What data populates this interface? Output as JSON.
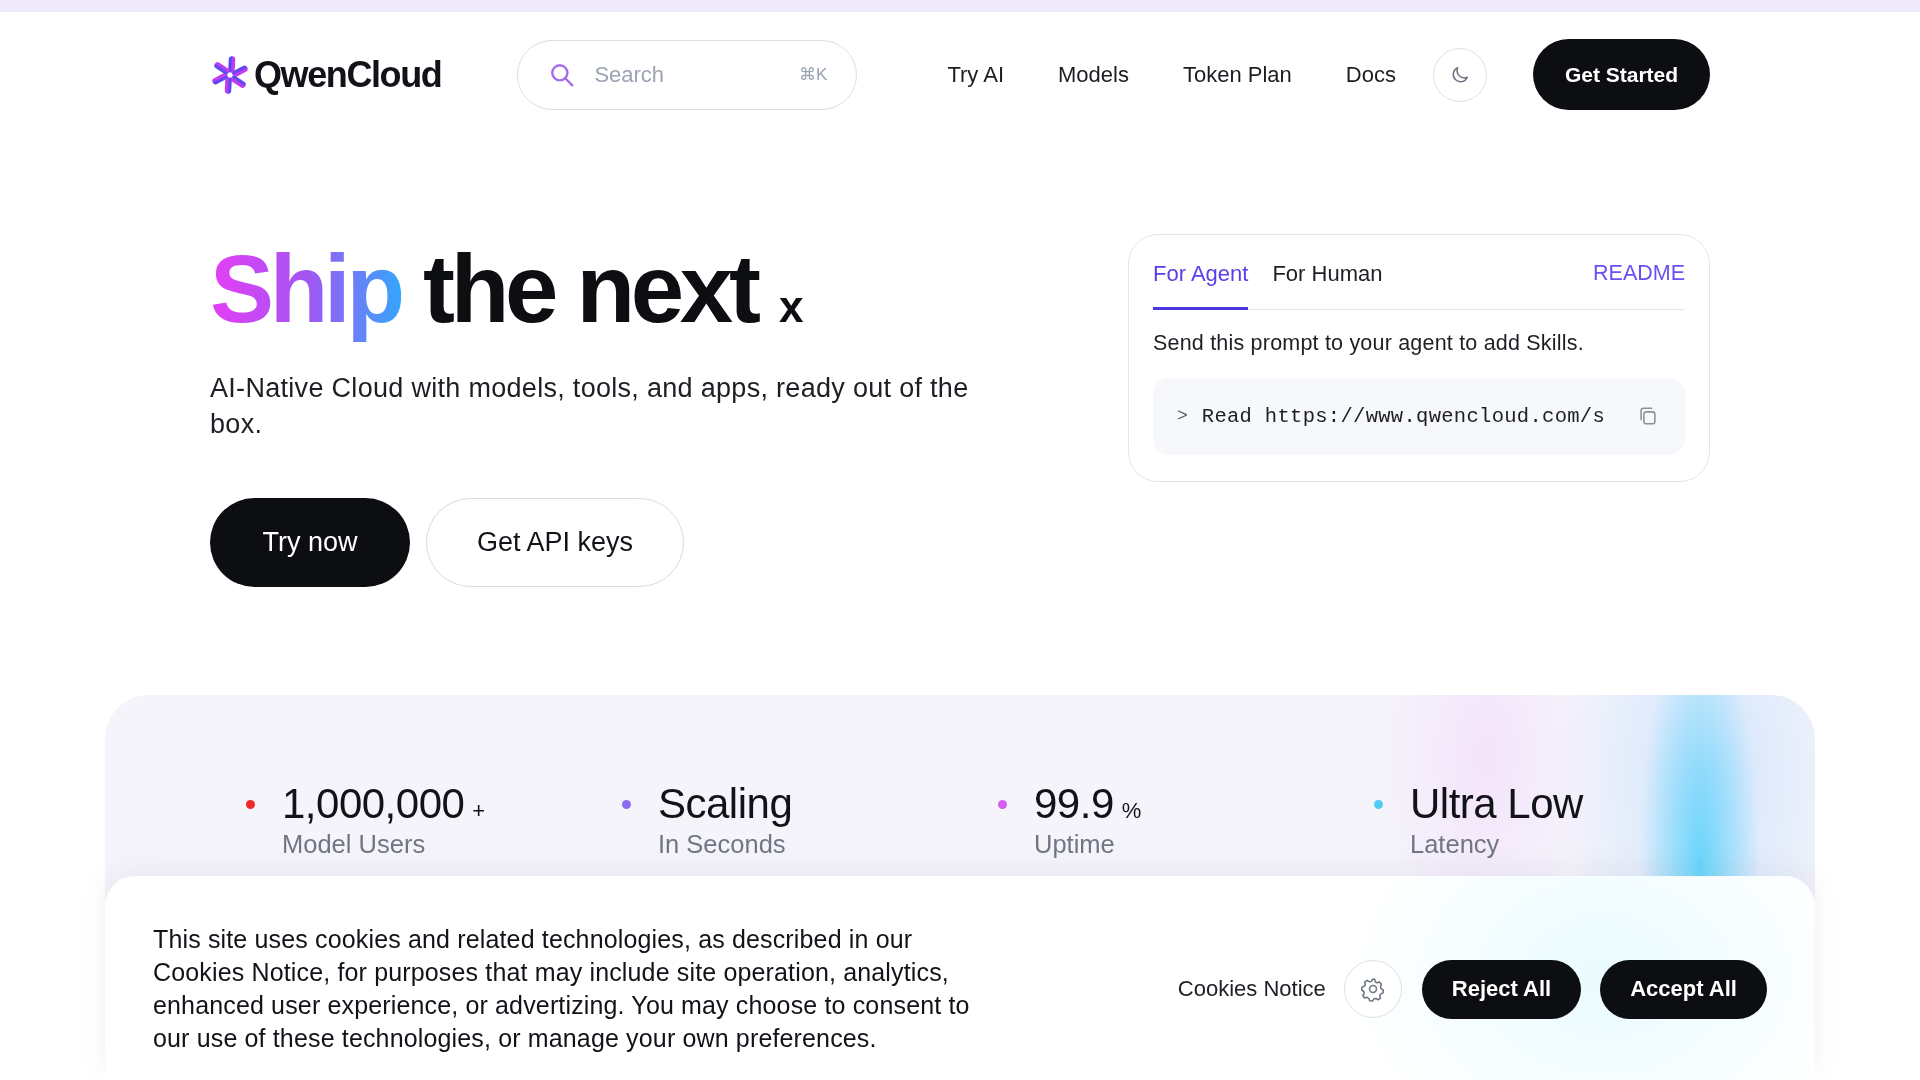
{
  "header": {
    "logo": "QwenCloud",
    "search": {
      "placeholder": "Search",
      "shortcut": "⌘K"
    },
    "nav": [
      "Try AI",
      "Models",
      "Token Plan",
      "Docs"
    ],
    "cta": "Get Started"
  },
  "hero": {
    "title": [
      {
        "text": "Ship",
        "kind": "gradient"
      },
      {
        "text": "the next",
        "kind": "plain"
      },
      {
        "text": "x",
        "kind": "small"
      }
    ],
    "subtitle": "AI-Native Cloud with models, tools, and apps, ready out of the box.",
    "buttons": [
      {
        "label": "Try now",
        "kind": "primary"
      },
      {
        "label": "Get API keys",
        "kind": "secondary"
      }
    ]
  },
  "prompt_card": {
    "tabs": [
      {
        "label": "For Agent",
        "selected": true
      },
      {
        "label": "For Human",
        "selected": false
      }
    ],
    "link": "README",
    "description": "Send this prompt to your agent to add Skills.",
    "prompt_marker": ">",
    "prompt": "Read https://www.qwencloud.com/s"
  },
  "stats": [
    {
      "value": "1,000,000",
      "suffix": "+",
      "label": "Model Users",
      "color": "#ee2b2b"
    },
    {
      "value": "Scaling",
      "label": "In Seconds",
      "color": "#8a6cf2"
    },
    {
      "value": "99.9",
      "suffix": "%",
      "label": "Uptime",
      "color": "#d75cf2"
    },
    {
      "value": "Ultra Low",
      "label": "Latency",
      "color": "#52cdf2"
    }
  ],
  "cookie_banner": {
    "text": "This site uses cookies and related technologies, as described in our Cookies Notice, for purposes that may include site operation, analytics, enhanced user experience, or advertizing. You may choose to consent to our use of these technologies, or manage your own preferences.",
    "notice_link": "Cookies Notice",
    "buttons": [
      {
        "label": "Reject All",
        "kind": "primary"
      },
      {
        "label": "Accept All",
        "kind": "primary"
      }
    ]
  }
}
